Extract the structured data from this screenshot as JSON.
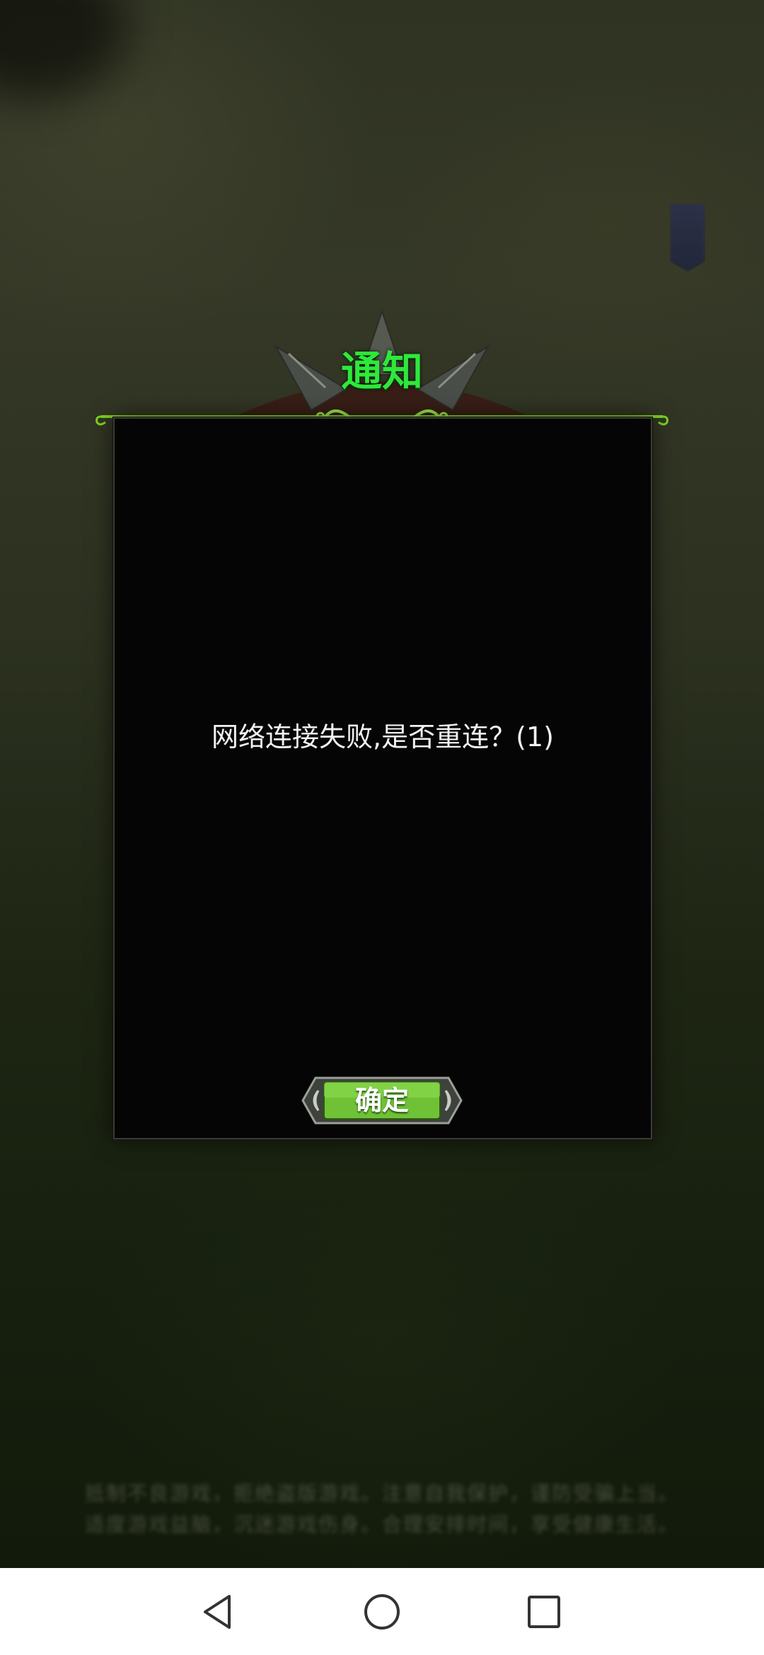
{
  "dialog": {
    "title": "通知",
    "message": "网络连接失败,是否重连？(1)",
    "confirm_label": "确定"
  },
  "background": {
    "notice_line1": "抵制不良游戏，拒绝盗版游戏。注意自我保护，谨防受骗上当。",
    "notice_line2": "适度游戏益脑，沉迷游戏伤身。合理安排时间，享受健康生活。"
  },
  "navigation": {
    "back": "back-icon",
    "home": "home-icon",
    "recent": "recent-apps-icon"
  },
  "colors": {
    "title_green": "#2ee83a",
    "button_green": "#6fc236",
    "panel_black": "#050505",
    "frame_green": "#7ed321"
  }
}
